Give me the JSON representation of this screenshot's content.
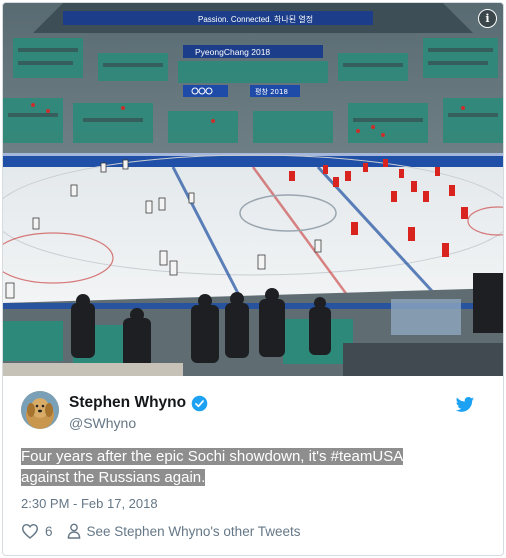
{
  "tweet": {
    "author_name": "Stephen Whyno",
    "author_handle": "@SWhyno",
    "text": "Four years after the epic Sochi showdown, it's #teamUSA against the Russians again.",
    "timestamp": "2:30 PM - Feb 17, 2018",
    "like_count": "6",
    "see_other_label": "See Stephen Whyno's other Tweets"
  },
  "photo": {
    "banner_top": "Passion. Connected. 하나된 열정",
    "banner_mid": "PyeongChang 2018",
    "banner_rings_label": "평창 2018"
  },
  "colors": {
    "twitter_blue": "#1da1f2",
    "usa_white": "#f4f4f4",
    "russia_red": "#d9231f",
    "rink_line_blue": "#1d4fa0"
  },
  "icons": [
    "info-icon",
    "verified-badge-icon",
    "twitter-bird-icon",
    "heart-icon",
    "person-icon"
  ]
}
